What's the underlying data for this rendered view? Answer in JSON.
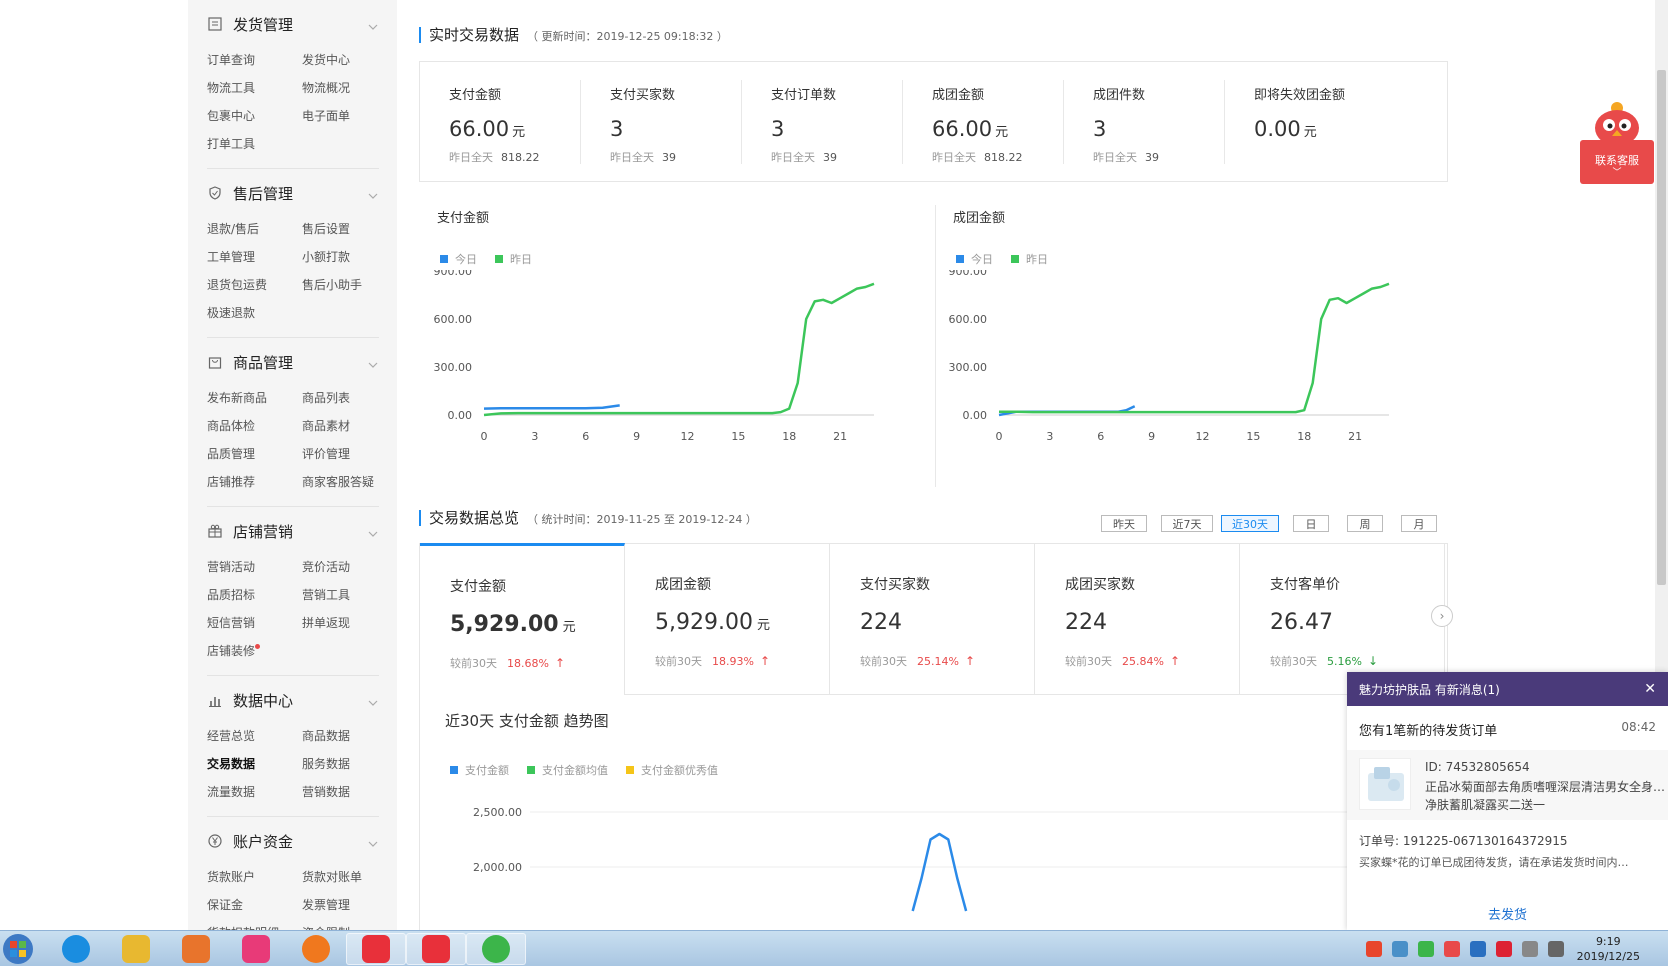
{
  "sidebar": {
    "sections": [
      {
        "title": "发货管理",
        "icon": "list-icon",
        "items": [
          "订单查询",
          "发货中心",
          "物流工具",
          "物流概况",
          "包裹中心",
          "电子面单",
          "打单工具"
        ]
      },
      {
        "title": "售后管理",
        "icon": "shield-icon",
        "items": [
          "退款/售后",
          "售后设置",
          "工单管理",
          "小额打款",
          "退货包运费",
          "售后小助手",
          "极速退款"
        ]
      },
      {
        "title": "商品管理",
        "icon": "bag-icon",
        "items": [
          "发布新商品",
          "商品列表",
          "商品体检",
          "商品素材",
          "品质管理",
          "评价管理",
          "店铺推荐",
          "商家客服答疑"
        ]
      },
      {
        "title": "店铺营销",
        "icon": "gift-icon",
        "items": [
          "营销活动",
          "竞价活动",
          "品质招标",
          "营销工具",
          "短信营销",
          "拼单返现",
          "店铺装修"
        ]
      },
      {
        "title": "数据中心",
        "icon": "bar-chart-icon",
        "items": [
          "经营总览",
          "商品数据",
          "交易数据",
          "服务数据",
          "流量数据",
          "营销数据"
        ],
        "active": "交易数据"
      },
      {
        "title": "账户资金",
        "icon": "yen-icon",
        "items": [
          "货款账户",
          "货款对账单",
          "保证金",
          "发票管理",
          "货款扣款明细",
          "资金限制"
        ]
      }
    ]
  },
  "realtime": {
    "title": "实时交易数据",
    "update_time": "（ 更新时间：2019-12-25 09:18:32 ）",
    "yesterday_label": "昨日全天",
    "unit": "元",
    "metrics": [
      {
        "label": "支付金额",
        "value": "66.00",
        "unit": "元",
        "yesterday": "818.22"
      },
      {
        "label": "支付买家数",
        "value": "3",
        "unit": "",
        "yesterday": "39"
      },
      {
        "label": "支付订单数",
        "value": "3",
        "unit": "",
        "yesterday": "39"
      },
      {
        "label": "成团金额",
        "value": "66.00",
        "unit": "元",
        "yesterday": "818.22"
      },
      {
        "label": "成团件数",
        "value": "3",
        "unit": "",
        "yesterday": "39"
      },
      {
        "label": "即将失效团金额",
        "value": "0.00",
        "unit": "元",
        "yesterday": ""
      }
    ]
  },
  "chart_data": [
    {
      "type": "line",
      "title": "支付金额",
      "x_ticks": [
        0,
        3,
        6,
        9,
        12,
        15,
        18,
        21
      ],
      "y_ticks": [
        "0.00",
        "300.00",
        "600.00",
        "900.00"
      ],
      "ylim": [
        0,
        900
      ],
      "xlim": [
        0,
        23
      ],
      "legend": "top-left",
      "grid": false,
      "series": [
        {
          "name": "今日",
          "color": "#2b8ae8",
          "x": [
            0,
            1,
            2,
            3,
            4,
            5,
            6,
            7,
            8
          ],
          "y": [
            40,
            42,
            42,
            42,
            42,
            42,
            42,
            45,
            60
          ]
        },
        {
          "name": "昨日",
          "color": "#3cc65a",
          "x": [
            0,
            1,
            2,
            3,
            4,
            5,
            6,
            7,
            8,
            9,
            10,
            11,
            12,
            13,
            14,
            15,
            16,
            17,
            17.5,
            18,
            18.5,
            19,
            19.5,
            20,
            20.5,
            21,
            21.5,
            22,
            22.5,
            23
          ],
          "y": [
            0,
            10,
            12,
            12,
            12,
            12,
            12,
            12,
            12,
            12,
            12,
            12,
            12,
            12,
            12,
            12,
            12,
            12,
            18,
            40,
            200,
            600,
            710,
            720,
            700,
            730,
            760,
            790,
            800,
            820
          ]
        }
      ]
    },
    {
      "type": "line",
      "title": "成团金额",
      "x_ticks": [
        0,
        3,
        6,
        9,
        12,
        15,
        18,
        21
      ],
      "y_ticks": [
        "0.00",
        "300.00",
        "600.00",
        "900.00"
      ],
      "ylim": [
        0,
        900
      ],
      "xlim": [
        0,
        23
      ],
      "legend": "top-left",
      "grid": false,
      "series": [
        {
          "name": "今日",
          "color": "#2b8ae8",
          "x": [
            0,
            1,
            2,
            3,
            4,
            5,
            6,
            7,
            7.5,
            8
          ],
          "y": [
            0,
            20,
            20,
            20,
            20,
            20,
            20,
            20,
            30,
            55
          ]
        },
        {
          "name": "昨日",
          "color": "#3cc65a",
          "x": [
            0,
            1,
            2,
            3,
            4,
            5,
            6,
            7,
            8,
            9,
            10,
            11,
            12,
            13,
            14,
            15,
            16,
            17,
            17.5,
            18,
            18.5,
            19,
            19.5,
            20,
            20.5,
            21,
            21.5,
            22,
            22.5,
            23
          ],
          "y": [
            20,
            20,
            18,
            18,
            18,
            18,
            18,
            18,
            18,
            18,
            18,
            18,
            18,
            18,
            18,
            18,
            18,
            18,
            18,
            30,
            200,
            600,
            720,
            730,
            700,
            730,
            760,
            790,
            800,
            820
          ]
        }
      ]
    },
    {
      "type": "line",
      "title": "近30天 支付金额 趋势图",
      "y_ticks": [
        "2,000.00",
        "2,500.00"
      ],
      "legend": "top-left",
      "grid": true,
      "series": [
        {
          "name": "支付金额",
          "color": "#2b8ae8",
          "x": [
            0.86,
            0.88,
            0.9,
            0.92,
            0.94,
            0.96,
            0.98
          ],
          "y": [
            1600,
            1900,
            2250,
            2300,
            2250,
            1900,
            1600
          ]
        },
        {
          "name": "支付金额均值",
          "color": "#3cc65a",
          "x": [],
          "y": []
        },
        {
          "name": "支付金额优秀值",
          "color": "#f5c518",
          "x": [],
          "y": []
        }
      ]
    }
  ],
  "overview": {
    "title": "交易数据总览",
    "stat_time": "（ 统计时间：2019-11-25 至 2019-12-24 ）",
    "periods": [
      "昨天",
      "近7天",
      "近30天",
      "日",
      "周",
      "月"
    ],
    "active_period": "近30天",
    "compare_label": "较前30天",
    "cards": [
      {
        "label": "支付金额",
        "value": "5,929.00",
        "unit": "元",
        "pct": "18.68%",
        "trend": "up"
      },
      {
        "label": "成团金额",
        "value": "5,929.00",
        "unit": "元",
        "pct": "18.93%",
        "trend": "up"
      },
      {
        "label": "支付买家数",
        "value": "224",
        "unit": "",
        "pct": "25.14%",
        "trend": "up"
      },
      {
        "label": "成团买家数",
        "value": "224",
        "unit": "",
        "pct": "25.84%",
        "trend": "up"
      },
      {
        "label": "支付客单价",
        "value": "26.47",
        "unit": "",
        "pct": "5.16%",
        "trend": "down"
      }
    ]
  },
  "service_widget": {
    "label": "联系客服"
  },
  "notification": {
    "header": "魅力坊护肤品 有新消息(1)",
    "title": "您有1笔新的待发货订单",
    "time": "08:42",
    "product_id": "ID: 74532805654",
    "product_name": "正品冰菊面部去角质嗜喱深层清洁男女全身…净肤蓄肌凝露买二送一",
    "order_no": "订单号: 191225-067130164372915",
    "message": "买家蝶*花的订单已成团待发货，请在承诺发货时间内…",
    "action": "去发货"
  },
  "taskbar": {
    "time": "9:19",
    "date": "2019/12/25",
    "apps": [
      "ie",
      "explorer",
      "media",
      "meitu",
      "firefox",
      "pinduoduo",
      "pinduoduo-merchant",
      "wechat"
    ]
  }
}
